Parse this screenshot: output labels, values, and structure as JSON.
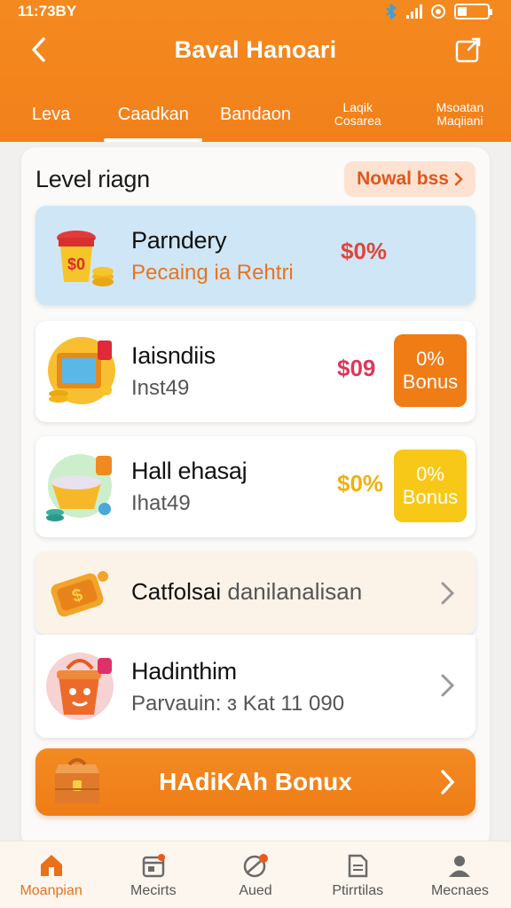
{
  "status": {
    "time": "11:73BY"
  },
  "header": {
    "title": "Baval Hanoari",
    "tabs": [
      {
        "label": "Leva",
        "active": false
      },
      {
        "label": "Caadkan",
        "active": true
      },
      {
        "label": "Bandaon",
        "active": false
      },
      {
        "label": "Laqik\nCosarea",
        "active": false,
        "small": true
      },
      {
        "label": "Msoatan\nMaqiiani",
        "active": false,
        "small": true
      }
    ]
  },
  "section": {
    "title": "Level riagn",
    "action_label": "Nowal bss"
  },
  "cards": [
    {
      "title": "Parndery",
      "subtitle": "Pecaing ia Rehtri",
      "percent": "$0%",
      "percent_color": "#e0453a",
      "style": "blue",
      "icon": "cup-coins-icon"
    },
    {
      "title": "Iaisndiis",
      "subtitle": "Inst49",
      "percent": "$09",
      "percent_color": "#e0355a",
      "bonus_top": "0%",
      "bonus_bottom": "Bonus",
      "bonus_color": "#f07c16",
      "icon": "tv-coins-icon"
    },
    {
      "title": "Hall ehasaj",
      "subtitle": "Ihat49",
      "percent": "$0%",
      "percent_color": "#f0b010",
      "bonus_top": "0%",
      "bonus_bottom": "Bonus",
      "bonus_color": "#f8c818",
      "icon": "bowl-icon"
    },
    {
      "title": "Catfolsai",
      "subtitle": "danilanalisan",
      "style": "cream",
      "icon": "tag-icon"
    },
    {
      "title": "Hadinthim",
      "subtitle": "Parvauin: ɜ Kat 11 090",
      "icon": "bucket-icon"
    }
  ],
  "cta": {
    "label": "HAdiKAh Bonux",
    "icon": "chest-icon"
  },
  "bottom_nav": [
    {
      "label": "Moanpian",
      "icon": "home-icon",
      "active": true
    },
    {
      "label": "Mecirts",
      "icon": "calendar-icon",
      "active": false
    },
    {
      "label": "Aued",
      "icon": "ball-icon",
      "active": false
    },
    {
      "label": "Ptirrtilas",
      "icon": "document-icon",
      "active": false
    },
    {
      "label": "Mecnaes",
      "icon": "profile-icon",
      "active": false
    }
  ],
  "colors": {
    "brand_orange": "#f2801a",
    "active_nav": "#e8711a"
  }
}
